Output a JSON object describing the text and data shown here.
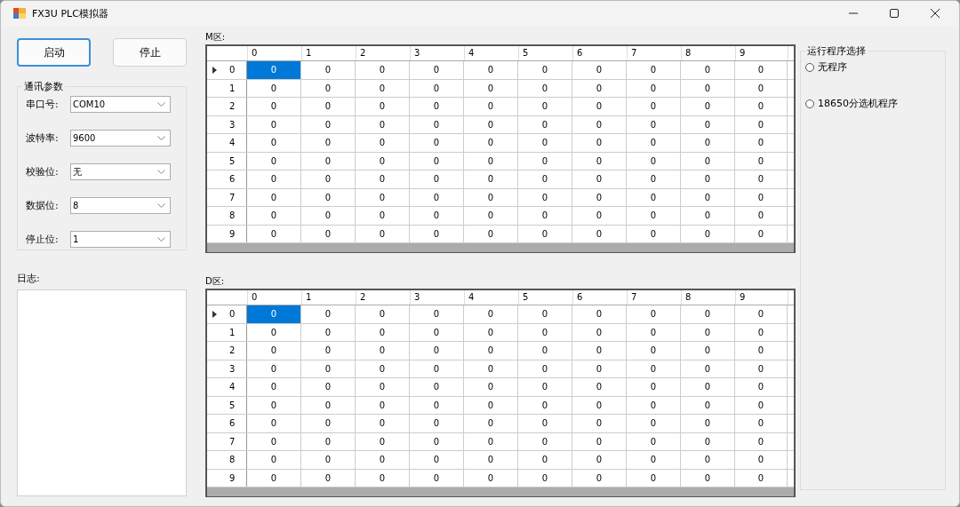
{
  "window": {
    "title": "FX3U PLC模拟器"
  },
  "buttons": [
    {
      "label": "启动",
      "focused": true
    },
    {
      "label": "停止",
      "focused": false
    }
  ],
  "comm_params": {
    "title": "通讯参数",
    "fields": [
      {
        "label": "串口号:",
        "value": "COM10"
      },
      {
        "label": "波特率:",
        "value": "9600"
      },
      {
        "label": "校验位:",
        "value": "无"
      },
      {
        "label": "数据位:",
        "value": "8"
      },
      {
        "label": "停止位:",
        "value": "1"
      }
    ]
  },
  "log": {
    "label": "日志:"
  },
  "grids": [
    {
      "label": "M区:",
      "columns": [
        "0",
        "1",
        "2",
        "3",
        "4",
        "5",
        "6",
        "7",
        "8",
        "9"
      ],
      "rows": [
        {
          "label": "0",
          "current": true,
          "cells": [
            {
              "value": "0",
              "selected": true
            },
            {
              "value": "0",
              "selected": false
            },
            {
              "value": "0",
              "selected": false
            },
            {
              "value": "0",
              "selected": false
            },
            {
              "value": "0",
              "selected": false
            },
            {
              "value": "0",
              "selected": false
            },
            {
              "value": "0",
              "selected": false
            },
            {
              "value": "0",
              "selected": false
            },
            {
              "value": "0",
              "selected": false
            },
            {
              "value": "0",
              "selected": false
            }
          ]
        },
        {
          "label": "1",
          "current": false,
          "cells": [
            {
              "value": "0",
              "selected": false
            },
            {
              "value": "0",
              "selected": false
            },
            {
              "value": "0",
              "selected": false
            },
            {
              "value": "0",
              "selected": false
            },
            {
              "value": "0",
              "selected": false
            },
            {
              "value": "0",
              "selected": false
            },
            {
              "value": "0",
              "selected": false
            },
            {
              "value": "0",
              "selected": false
            },
            {
              "value": "0",
              "selected": false
            },
            {
              "value": "0",
              "selected": false
            }
          ]
        },
        {
          "label": "2",
          "current": false,
          "cells": [
            {
              "value": "0",
              "selected": false
            },
            {
              "value": "0",
              "selected": false
            },
            {
              "value": "0",
              "selected": false
            },
            {
              "value": "0",
              "selected": false
            },
            {
              "value": "0",
              "selected": false
            },
            {
              "value": "0",
              "selected": false
            },
            {
              "value": "0",
              "selected": false
            },
            {
              "value": "0",
              "selected": false
            },
            {
              "value": "0",
              "selected": false
            },
            {
              "value": "0",
              "selected": false
            }
          ]
        },
        {
          "label": "3",
          "current": false,
          "cells": [
            {
              "value": "0",
              "selected": false
            },
            {
              "value": "0",
              "selected": false
            },
            {
              "value": "0",
              "selected": false
            },
            {
              "value": "0",
              "selected": false
            },
            {
              "value": "0",
              "selected": false
            },
            {
              "value": "0",
              "selected": false
            },
            {
              "value": "0",
              "selected": false
            },
            {
              "value": "0",
              "selected": false
            },
            {
              "value": "0",
              "selected": false
            },
            {
              "value": "0",
              "selected": false
            }
          ]
        },
        {
          "label": "4",
          "current": false,
          "cells": [
            {
              "value": "0",
              "selected": false
            },
            {
              "value": "0",
              "selected": false
            },
            {
              "value": "0",
              "selected": false
            },
            {
              "value": "0",
              "selected": false
            },
            {
              "value": "0",
              "selected": false
            },
            {
              "value": "0",
              "selected": false
            },
            {
              "value": "0",
              "selected": false
            },
            {
              "value": "0",
              "selected": false
            },
            {
              "value": "0",
              "selected": false
            },
            {
              "value": "0",
              "selected": false
            }
          ]
        },
        {
          "label": "5",
          "current": false,
          "cells": [
            {
              "value": "0",
              "selected": false
            },
            {
              "value": "0",
              "selected": false
            },
            {
              "value": "0",
              "selected": false
            },
            {
              "value": "0",
              "selected": false
            },
            {
              "value": "0",
              "selected": false
            },
            {
              "value": "0",
              "selected": false
            },
            {
              "value": "0",
              "selected": false
            },
            {
              "value": "0",
              "selected": false
            },
            {
              "value": "0",
              "selected": false
            },
            {
              "value": "0",
              "selected": false
            }
          ]
        },
        {
          "label": "6",
          "current": false,
          "cells": [
            {
              "value": "0",
              "selected": false
            },
            {
              "value": "0",
              "selected": false
            },
            {
              "value": "0",
              "selected": false
            },
            {
              "value": "0",
              "selected": false
            },
            {
              "value": "0",
              "selected": false
            },
            {
              "value": "0",
              "selected": false
            },
            {
              "value": "0",
              "selected": false
            },
            {
              "value": "0",
              "selected": false
            },
            {
              "value": "0",
              "selected": false
            },
            {
              "value": "0",
              "selected": false
            }
          ]
        },
        {
          "label": "7",
          "current": false,
          "cells": [
            {
              "value": "0",
              "selected": false
            },
            {
              "value": "0",
              "selected": false
            },
            {
              "value": "0",
              "selected": false
            },
            {
              "value": "0",
              "selected": false
            },
            {
              "value": "0",
              "selected": false
            },
            {
              "value": "0",
              "selected": false
            },
            {
              "value": "0",
              "selected": false
            },
            {
              "value": "0",
              "selected": false
            },
            {
              "value": "0",
              "selected": false
            },
            {
              "value": "0",
              "selected": false
            }
          ]
        },
        {
          "label": "8",
          "current": false,
          "cells": [
            {
              "value": "0",
              "selected": false
            },
            {
              "value": "0",
              "selected": false
            },
            {
              "value": "0",
              "selected": false
            },
            {
              "value": "0",
              "selected": false
            },
            {
              "value": "0",
              "selected": false
            },
            {
              "value": "0",
              "selected": false
            },
            {
              "value": "0",
              "selected": false
            },
            {
              "value": "0",
              "selected": false
            },
            {
              "value": "0",
              "selected": false
            },
            {
              "value": "0",
              "selected": false
            }
          ]
        },
        {
          "label": "9",
          "current": false,
          "cells": [
            {
              "value": "0",
              "selected": false
            },
            {
              "value": "0",
              "selected": false
            },
            {
              "value": "0",
              "selected": false
            },
            {
              "value": "0",
              "selected": false
            },
            {
              "value": "0",
              "selected": false
            },
            {
              "value": "0",
              "selected": false
            },
            {
              "value": "0",
              "selected": false
            },
            {
              "value": "0",
              "selected": false
            },
            {
              "value": "0",
              "selected": false
            },
            {
              "value": "0",
              "selected": false
            }
          ]
        }
      ]
    },
    {
      "label": "D区:",
      "columns": [
        "0",
        "1",
        "2",
        "3",
        "4",
        "5",
        "6",
        "7",
        "8",
        "9"
      ],
      "rows": [
        {
          "label": "0",
          "current": true,
          "cells": [
            {
              "value": "0",
              "selected": true
            },
            {
              "value": "0",
              "selected": false
            },
            {
              "value": "0",
              "selected": false
            },
            {
              "value": "0",
              "selected": false
            },
            {
              "value": "0",
              "selected": false
            },
            {
              "value": "0",
              "selected": false
            },
            {
              "value": "0",
              "selected": false
            },
            {
              "value": "0",
              "selected": false
            },
            {
              "value": "0",
              "selected": false
            },
            {
              "value": "0",
              "selected": false
            }
          ]
        },
        {
          "label": "1",
          "current": false,
          "cells": [
            {
              "value": "0",
              "selected": false
            },
            {
              "value": "0",
              "selected": false
            },
            {
              "value": "0",
              "selected": false
            },
            {
              "value": "0",
              "selected": false
            },
            {
              "value": "0",
              "selected": false
            },
            {
              "value": "0",
              "selected": false
            },
            {
              "value": "0",
              "selected": false
            },
            {
              "value": "0",
              "selected": false
            },
            {
              "value": "0",
              "selected": false
            },
            {
              "value": "0",
              "selected": false
            }
          ]
        },
        {
          "label": "2",
          "current": false,
          "cells": [
            {
              "value": "0",
              "selected": false
            },
            {
              "value": "0",
              "selected": false
            },
            {
              "value": "0",
              "selected": false
            },
            {
              "value": "0",
              "selected": false
            },
            {
              "value": "0",
              "selected": false
            },
            {
              "value": "0",
              "selected": false
            },
            {
              "value": "0",
              "selected": false
            },
            {
              "value": "0",
              "selected": false
            },
            {
              "value": "0",
              "selected": false
            },
            {
              "value": "0",
              "selected": false
            }
          ]
        },
        {
          "label": "3",
          "current": false,
          "cells": [
            {
              "value": "0",
              "selected": false
            },
            {
              "value": "0",
              "selected": false
            },
            {
              "value": "0",
              "selected": false
            },
            {
              "value": "0",
              "selected": false
            },
            {
              "value": "0",
              "selected": false
            },
            {
              "value": "0",
              "selected": false
            },
            {
              "value": "0",
              "selected": false
            },
            {
              "value": "0",
              "selected": false
            },
            {
              "value": "0",
              "selected": false
            },
            {
              "value": "0",
              "selected": false
            }
          ]
        },
        {
          "label": "4",
          "current": false,
          "cells": [
            {
              "value": "0",
              "selected": false
            },
            {
              "value": "0",
              "selected": false
            },
            {
              "value": "0",
              "selected": false
            },
            {
              "value": "0",
              "selected": false
            },
            {
              "value": "0",
              "selected": false
            },
            {
              "value": "0",
              "selected": false
            },
            {
              "value": "0",
              "selected": false
            },
            {
              "value": "0",
              "selected": false
            },
            {
              "value": "0",
              "selected": false
            },
            {
              "value": "0",
              "selected": false
            }
          ]
        },
        {
          "label": "5",
          "current": false,
          "cells": [
            {
              "value": "0",
              "selected": false
            },
            {
              "value": "0",
              "selected": false
            },
            {
              "value": "0",
              "selected": false
            },
            {
              "value": "0",
              "selected": false
            },
            {
              "value": "0",
              "selected": false
            },
            {
              "value": "0",
              "selected": false
            },
            {
              "value": "0",
              "selected": false
            },
            {
              "value": "0",
              "selected": false
            },
            {
              "value": "0",
              "selected": false
            },
            {
              "value": "0",
              "selected": false
            }
          ]
        },
        {
          "label": "6",
          "current": false,
          "cells": [
            {
              "value": "0",
              "selected": false
            },
            {
              "value": "0",
              "selected": false
            },
            {
              "value": "0",
              "selected": false
            },
            {
              "value": "0",
              "selected": false
            },
            {
              "value": "0",
              "selected": false
            },
            {
              "value": "0",
              "selected": false
            },
            {
              "value": "0",
              "selected": false
            },
            {
              "value": "0",
              "selected": false
            },
            {
              "value": "0",
              "selected": false
            },
            {
              "value": "0",
              "selected": false
            }
          ]
        },
        {
          "label": "7",
          "current": false,
          "cells": [
            {
              "value": "0",
              "selected": false
            },
            {
              "value": "0",
              "selected": false
            },
            {
              "value": "0",
              "selected": false
            },
            {
              "value": "0",
              "selected": false
            },
            {
              "value": "0",
              "selected": false
            },
            {
              "value": "0",
              "selected": false
            },
            {
              "value": "0",
              "selected": false
            },
            {
              "value": "0",
              "selected": false
            },
            {
              "value": "0",
              "selected": false
            },
            {
              "value": "0",
              "selected": false
            }
          ]
        },
        {
          "label": "8",
          "current": false,
          "cells": [
            {
              "value": "0",
              "selected": false
            },
            {
              "value": "0",
              "selected": false
            },
            {
              "value": "0",
              "selected": false
            },
            {
              "value": "0",
              "selected": false
            },
            {
              "value": "0",
              "selected": false
            },
            {
              "value": "0",
              "selected": false
            },
            {
              "value": "0",
              "selected": false
            },
            {
              "value": "0",
              "selected": false
            },
            {
              "value": "0",
              "selected": false
            },
            {
              "value": "0",
              "selected": false
            }
          ]
        },
        {
          "label": "9",
          "current": false,
          "cells": [
            {
              "value": "0",
              "selected": false
            },
            {
              "value": "0",
              "selected": false
            },
            {
              "value": "0",
              "selected": false
            },
            {
              "value": "0",
              "selected": false
            },
            {
              "value": "0",
              "selected": false
            },
            {
              "value": "0",
              "selected": false
            },
            {
              "value": "0",
              "selected": false
            },
            {
              "value": "0",
              "selected": false
            },
            {
              "value": "0",
              "selected": false
            },
            {
              "value": "0",
              "selected": false
            }
          ]
        }
      ]
    }
  ],
  "program_select": {
    "title": "运行程序选择",
    "options": [
      {
        "label": "无程序",
        "selected": false
      },
      {
        "label": "18650分选机程序",
        "selected": false
      }
    ]
  }
}
